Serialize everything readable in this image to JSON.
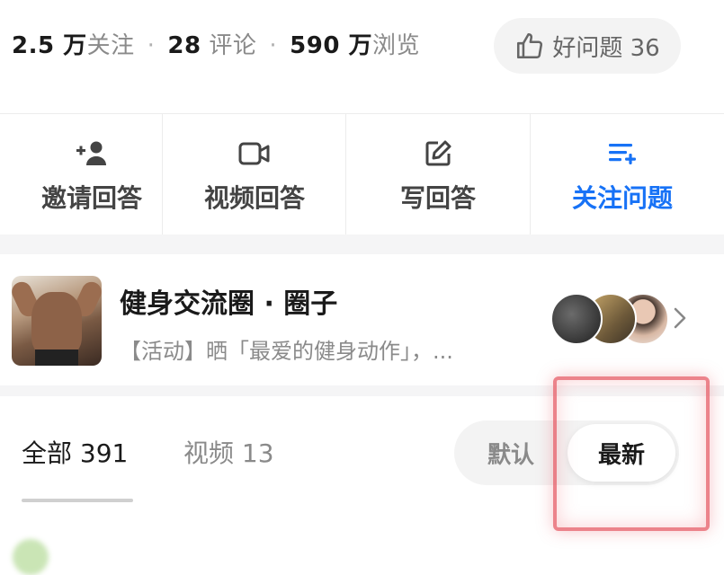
{
  "stats": {
    "followers_num": "2.5 万",
    "followers_label": "关注",
    "comments_num": "28",
    "comments_label": "评论",
    "views_num": "590 万",
    "views_label": "浏览",
    "separator": "·"
  },
  "good_question": {
    "label": "好问题 36",
    "icon": "thumbs-up-icon"
  },
  "actions": [
    {
      "label": "邀请回答",
      "icon": "add-user-icon"
    },
    {
      "label": "视频回答",
      "icon": "video-camera-icon"
    },
    {
      "label": "写回答",
      "icon": "edit-icon"
    },
    {
      "label": "关注问题",
      "icon": "follow-list-icon",
      "active": true
    }
  ],
  "circle": {
    "title": "健身交流圈 · 圈子",
    "desc": "【活动】晒「最爱的健身动作」，...",
    "icon": "chevron-right-icon"
  },
  "tabs": [
    {
      "label": "全部 391",
      "active": true
    },
    {
      "label": "视频 13",
      "active": false
    }
  ],
  "sort": {
    "default_label": "默认",
    "newest_label": "最新",
    "selected": "最新"
  },
  "colors": {
    "accent": "#1772f6",
    "muted": "#8a8a8a",
    "highlight": "#e65a64"
  }
}
